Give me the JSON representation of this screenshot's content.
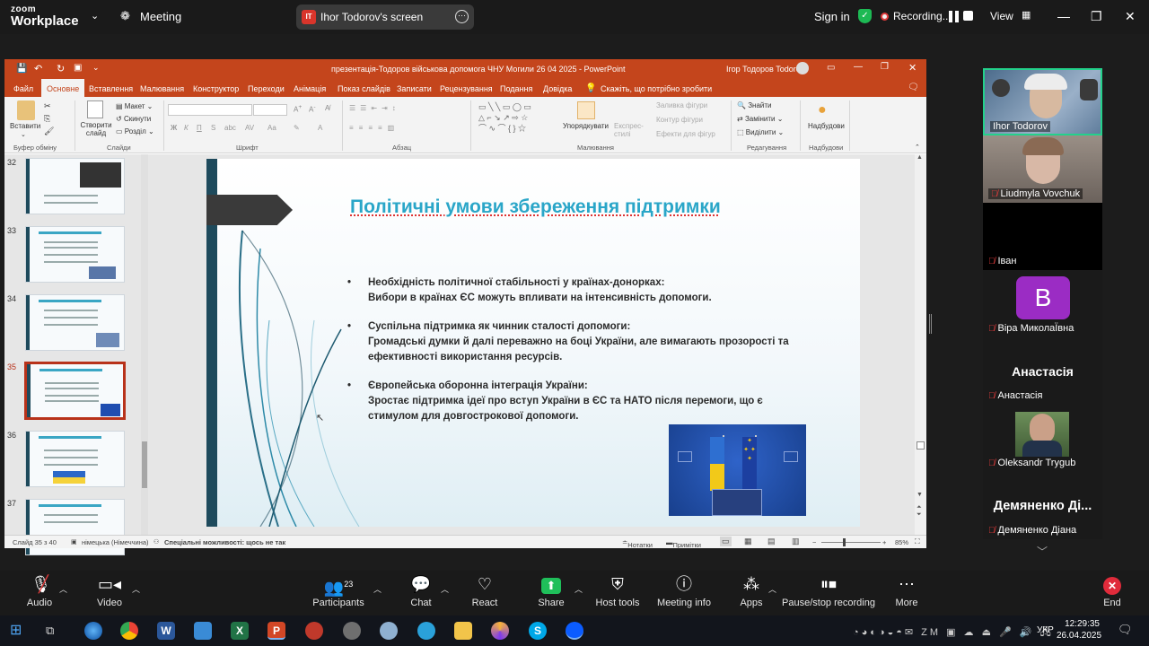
{
  "zoom": {
    "brand_top": "zoom",
    "brand_bottom": "Workplace",
    "meeting_label": "Meeting",
    "screen_share_label": "Ihor Todorov's screen",
    "screen_share_badge": "IT",
    "sign_in": "Sign in",
    "recording_label": "Recording...",
    "view_label": "View"
  },
  "ppt": {
    "window_title": "презентація-Тодоров військова допомога ЧНУ Могили 26 04 2025  -  PowerPoint",
    "user_name": "Ігор Тодоров Todorov",
    "tabs": [
      "Файл",
      "Основне",
      "Вставлення",
      "Малювання",
      "Конструктор",
      "Переходи",
      "Анімація",
      "Показ слайдів",
      "Записати",
      "Рецензування",
      "Подання",
      "Довідка"
    ],
    "tell_me": "Скажіть, що потрібно зробити",
    "ribbon": {
      "paste": "Вставити",
      "new_slide": "Створити слайд",
      "layout": "Макет",
      "reset": "Скинути",
      "section": "Розділ",
      "arrange": "Упорядкувати",
      "quick_styles": "Експрес-стилі",
      "shape_fill": "Заливка фігури",
      "shape_outline": "Контур фігури",
      "shape_effects": "Ефекти для фігур",
      "find": "Знайти",
      "replace": "Замінити",
      "select": "Виділити",
      "addins": "Надбудови",
      "groups": [
        "Буфер обміну",
        "Слайди",
        "Шрифт",
        "Абзац",
        "Малювання",
        "Редагування",
        "Надбудови"
      ]
    },
    "thumb_numbers": [
      "32",
      "33",
      "34",
      "35",
      "36",
      "37"
    ],
    "slide": {
      "title": "Політичні умови збереження підтримки",
      "bullets": [
        {
          "head": "Необхідність політичної стабільності у країнах-донорках:",
          "body": "Вибори в країнах ЄС можуть впливати на інтенсивність допомоги."
        },
        {
          "head": "Суспільна підтримка як чинник сталості допомоги:",
          "body": "Громадські думки й далі переважно на боці України, але вимагають прозорості та ефективності використання ресурсів."
        },
        {
          "head": "Європейська оборонна інтеграція України:",
          "body": "Зростає підтримка ідеї про вступ України в ЄС та НАТО після перемоги, що є стимулом для довгострокової допомоги."
        }
      ]
    },
    "status": {
      "slide_counter": "Слайд 35 з 40",
      "language": "німецька (Німеччина)",
      "accessibility": "Спеціальні можливості: щось не так",
      "notes": "Нотатки",
      "comments": "Примітки",
      "zoom": "85%"
    }
  },
  "participants": [
    {
      "name": "Ihor Todorov",
      "muted": false,
      "kind": "video"
    },
    {
      "name": "Liudmyla Vovchuk",
      "muted": true,
      "kind": "video"
    },
    {
      "name": "Іван",
      "muted": true,
      "kind": "blank"
    },
    {
      "name": "Віра МиколаЇвна",
      "muted": true,
      "kind": "avatar",
      "initial": "B"
    },
    {
      "name": "Анастасія",
      "muted": true,
      "kind": "text",
      "big": "Анастасія"
    },
    {
      "name": "Oleksandr Trygub",
      "muted": true,
      "kind": "video"
    },
    {
      "name": "Демяненко Діана",
      "muted": true,
      "kind": "text",
      "big": "Демяненко Ді..."
    }
  ],
  "toolbar": {
    "audio": "Audio",
    "video": "Video",
    "participants": "Participants",
    "participants_count": "23",
    "chat": "Chat",
    "react": "React",
    "share": "Share",
    "host_tools": "Host tools",
    "meeting_info": "Meeting info",
    "apps": "Apps",
    "recording": "Pause/stop recording",
    "more": "More",
    "end": "End"
  },
  "taskbar": {
    "time": "12:29:35",
    "date": "26.04.2025",
    "lang": "УКР"
  },
  "colors": {
    "ppt_accent": "#c4451c",
    "slide_title": "#2aa6c8",
    "zoom_share": "#1fbf5a",
    "end_red": "#e02b3b"
  }
}
